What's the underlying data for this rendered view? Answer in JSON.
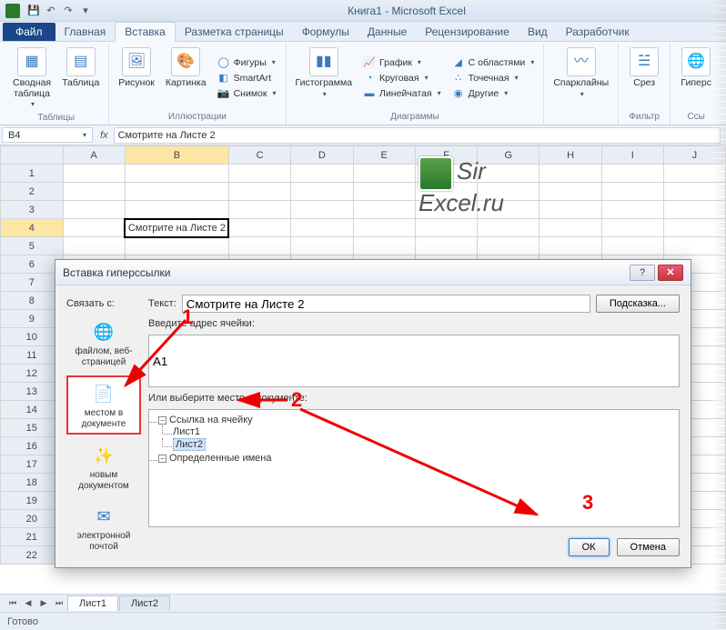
{
  "titlebar": {
    "title": "Книга1 - Microsoft Excel"
  },
  "tabs": {
    "file": "Файл",
    "items": [
      "Главная",
      "Вставка",
      "Разметка страницы",
      "Формулы",
      "Данные",
      "Рецензирование",
      "Вид",
      "Разработчик"
    ],
    "active_index": 1
  },
  "ribbon": {
    "groups": {
      "tables": {
        "label": "Таблицы",
        "pivot": "Сводная\nтаблица",
        "table": "Таблица"
      },
      "illustrations": {
        "label": "Иллюстрации",
        "picture": "Рисунок",
        "clipart": "Картинка",
        "shapes": "Фигуры",
        "smartart": "SmartArt",
        "screenshot": "Снимок"
      },
      "charts": {
        "label": "Диаграммы",
        "column": "Гистограмма",
        "line_ch": "График",
        "pie": "Круговая",
        "bar": "Линейчатая",
        "area": "С областями",
        "scatter": "Точечная",
        "other": "Другие"
      },
      "sparklines": {
        "label": "",
        "btn": "Спарклайны"
      },
      "filter": {
        "label": "Фильтр",
        "slicer": "Срез"
      },
      "links": {
        "label": "Ссы",
        "hyper": "Гиперс"
      }
    }
  },
  "formula_bar": {
    "cell_ref": "B4",
    "fx": "fx",
    "formula": "Смотрите на Листе 2"
  },
  "columns": [
    "A",
    "B",
    "C",
    "D",
    "E",
    "F",
    "G",
    "H",
    "I",
    "J"
  ],
  "rows": 22,
  "selected_cell": {
    "row": 4,
    "col": "B",
    "text": "Смотрите на Листе 2"
  },
  "watermark": {
    "l1": "Sir",
    "l2": "Excel.ru"
  },
  "dialog": {
    "title": "Вставка гиперссылки",
    "link_with": "Связать с:",
    "text_label": "Текст:",
    "text_value": "Смотрите на Листе 2",
    "hint_btn": "Подсказка...",
    "addr_label": "Введите адрес ячейки:",
    "addr_value": "A1",
    "place_label": "Или выберите место в документе:",
    "tree": {
      "root": "Ссылка на ячейку",
      "items": [
        "Лист1",
        "Лист2"
      ],
      "selected_index": 1,
      "defined": "Определенные имена"
    },
    "nav": [
      {
        "id": "file-web",
        "label": "файлом, веб-страницей"
      },
      {
        "id": "place-in-doc",
        "label": "местом в документе"
      },
      {
        "id": "new-doc",
        "label": "новым документом"
      },
      {
        "id": "email",
        "label": "электронной почтой"
      }
    ],
    "nav_selected": 1,
    "ok": "ОК",
    "cancel": "Отмена"
  },
  "callouts": {
    "c1": "1",
    "c2": "2",
    "c3": "3"
  },
  "sheets": {
    "tabs": [
      "Лист1",
      "Лист2"
    ],
    "active": 0
  },
  "status": "Готово"
}
